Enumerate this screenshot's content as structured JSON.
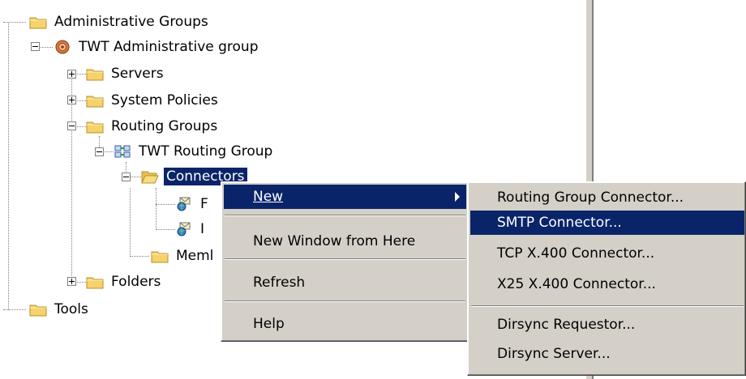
{
  "tree": {
    "administrative_groups": "Administrative Groups",
    "twt_admin_group": "TWT Administrative group",
    "servers": "Servers",
    "system_policies": "System Policies",
    "routing_groups": "Routing Groups",
    "twt_routing_group": "TWT Routing Group",
    "connectors": "Connectors",
    "connector_1_partial": "F",
    "connector_2_partial": "I",
    "members_partial": "Meml",
    "folders": "Folders",
    "tools": "Tools"
  },
  "context_menu": {
    "new_label": "New",
    "new_window_label": "New Window from Here",
    "refresh_label": "Refresh",
    "help_label": "Help"
  },
  "submenu": {
    "items": [
      "Routing Group Connector...",
      "SMTP Connector...",
      "TCP X.400 Connector...",
      "X25 X.400 Connector...",
      "Dirsync Requestor...",
      "Dirsync Server..."
    ],
    "highlighted": "SMTP Connector..."
  },
  "colors": {
    "selection": "#0a246a",
    "menu_bg": "#d4d0c8",
    "folder": "#f5d26a"
  }
}
